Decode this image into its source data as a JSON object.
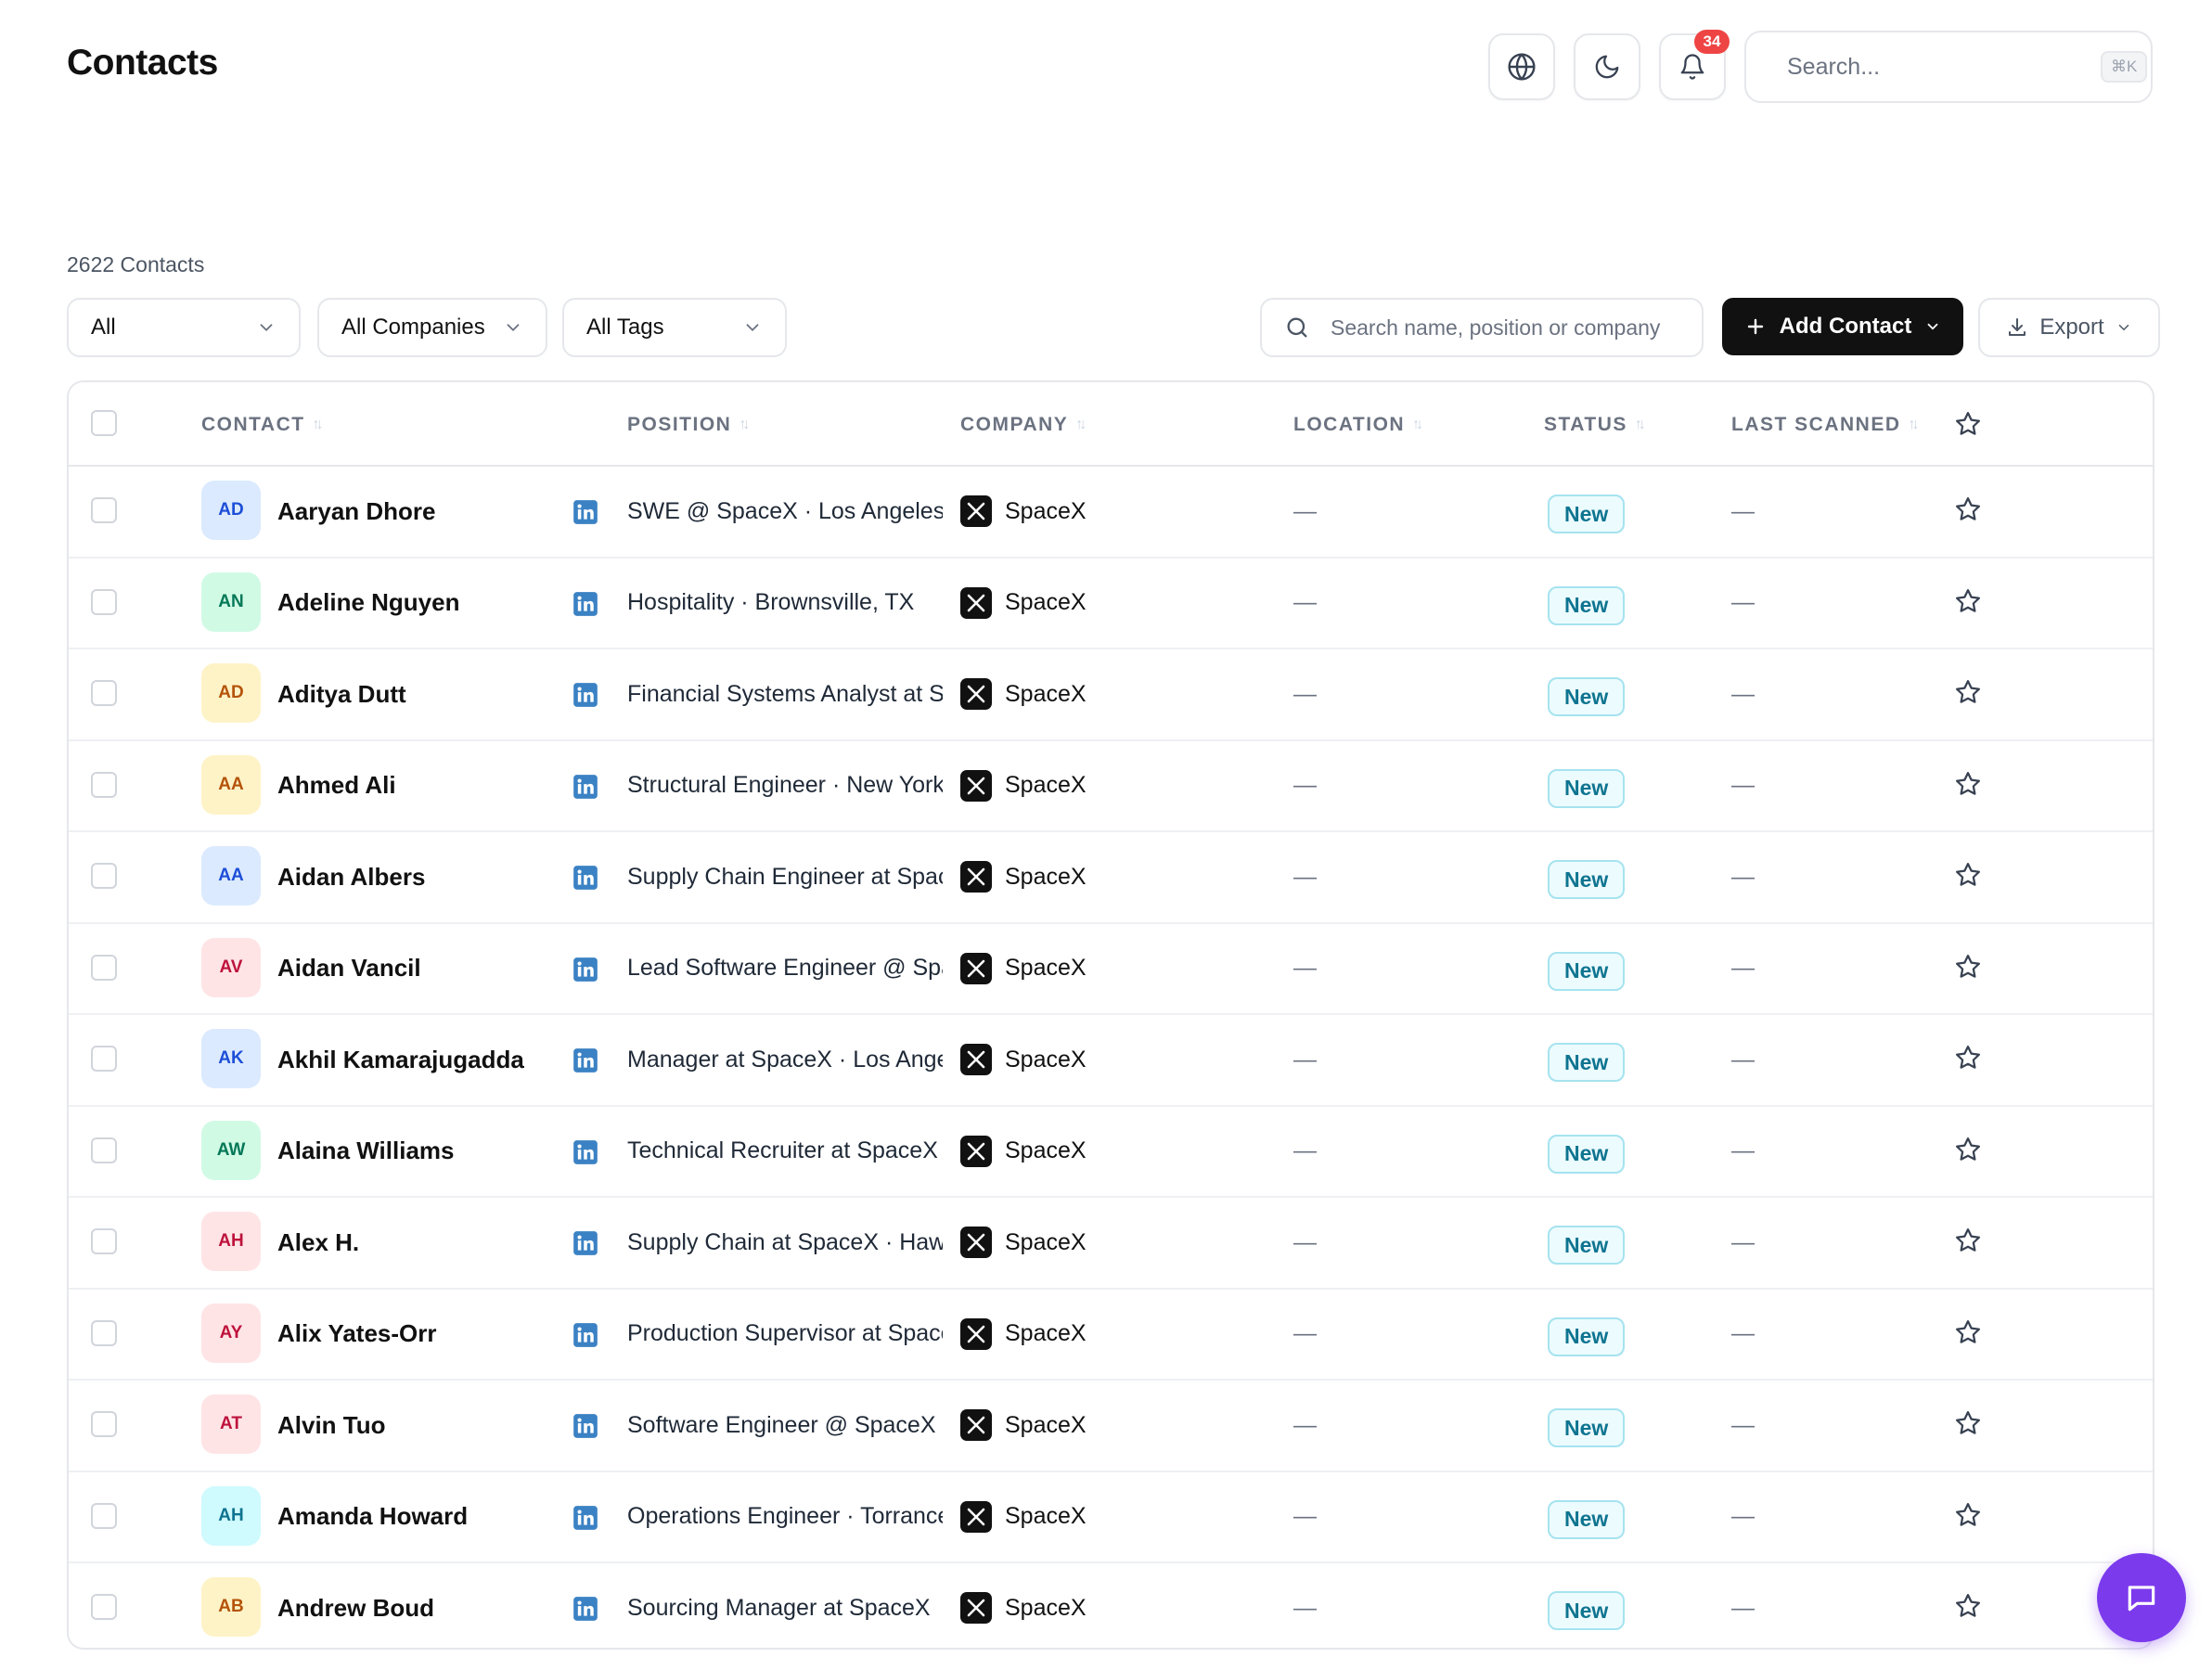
{
  "header": {
    "title": "Contacts",
    "notification_count": "34",
    "search_placeholder": "Search...",
    "search_shortcut": "⌘K",
    "icons": [
      "globe-icon",
      "moon-icon",
      "bell-icon",
      "search-icon"
    ]
  },
  "contacts_count_label": "2622 Contacts",
  "filters": {
    "view": "All",
    "companies": "All Companies",
    "tags": "All Tags",
    "table_search_placeholder": "Search name, position or company",
    "add_contact_label": "Add Contact",
    "export_label": "Export"
  },
  "table": {
    "columns": {
      "contact": "CONTACT",
      "position": "POSITION",
      "company": "COMPANY",
      "location": "LOCATION",
      "status": "STATUS",
      "last_scanned": "LAST SCANNED"
    },
    "rows": [
      {
        "initials": "AD",
        "name": "Aaryan Dhore",
        "position": "SWE @ SpaceX · Los Angeles, CA",
        "company": "SpaceX",
        "location": "—",
        "status": "New",
        "last_scanned": "—",
        "avatar_bg": "#dbeafe",
        "avatar_fg": "#1d4ed8"
      },
      {
        "initials": "AN",
        "name": "Adeline Nguyen",
        "position": "Hospitality · Brownsville, TX",
        "company": "SpaceX",
        "location": "—",
        "status": "New",
        "last_scanned": "—",
        "avatar_bg": "#d1fae5",
        "avatar_fg": "#047857"
      },
      {
        "initials": "AD",
        "name": "Aditya Dutt",
        "position": "Financial Systems Analyst at SpaceX",
        "company": "SpaceX",
        "location": "—",
        "status": "New",
        "last_scanned": "—",
        "avatar_bg": "#fef3c7",
        "avatar_fg": "#b45309"
      },
      {
        "initials": "AA",
        "name": "Ahmed Ali",
        "position": "Structural Engineer · New York",
        "company": "SpaceX",
        "location": "—",
        "status": "New",
        "last_scanned": "—",
        "avatar_bg": "#fef3c7",
        "avatar_fg": "#b45309"
      },
      {
        "initials": "AA",
        "name": "Aidan Albers",
        "position": "Supply Chain Engineer at SpaceX",
        "company": "SpaceX",
        "location": "—",
        "status": "New",
        "last_scanned": "—",
        "avatar_bg": "#dbeafe",
        "avatar_fg": "#1d4ed8"
      },
      {
        "initials": "AV",
        "name": "Aidan Vancil",
        "position": "Lead Software Engineer @ SpaceX",
        "company": "SpaceX",
        "location": "—",
        "status": "New",
        "last_scanned": "—",
        "avatar_bg": "#ffe4e6",
        "avatar_fg": "#be123c"
      },
      {
        "initials": "AK",
        "name": "Akhil Kamarajugadda",
        "position": "Manager at SpaceX · Los Angeles",
        "company": "SpaceX",
        "location": "—",
        "status": "New",
        "last_scanned": "—",
        "avatar_bg": "#dbeafe",
        "avatar_fg": "#1d4ed8"
      },
      {
        "initials": "AW",
        "name": "Alaina Williams",
        "position": "Technical Recruiter at SpaceX",
        "company": "SpaceX",
        "location": "—",
        "status": "New",
        "last_scanned": "—",
        "avatar_bg": "#d1fae5",
        "avatar_fg": "#047857"
      },
      {
        "initials": "AH",
        "name": "Alex H.",
        "position": "Supply Chain at SpaceX · Hawthorne",
        "company": "SpaceX",
        "location": "—",
        "status": "New",
        "last_scanned": "—",
        "avatar_bg": "#ffe4e6",
        "avatar_fg": "#be123c"
      },
      {
        "initials": "AY",
        "name": "Alix Yates-Orr",
        "position": "Production Supervisor at SpaceX",
        "company": "SpaceX",
        "location": "—",
        "status": "New",
        "last_scanned": "—",
        "avatar_bg": "#ffe4e6",
        "avatar_fg": "#be123c"
      },
      {
        "initials": "AT",
        "name": "Alvin Tuo",
        "position": "Software Engineer @ SpaceX",
        "company": "SpaceX",
        "location": "—",
        "status": "New",
        "last_scanned": "—",
        "avatar_bg": "#ffe4e6",
        "avatar_fg": "#be123c"
      },
      {
        "initials": "AH",
        "name": "Amanda Howard",
        "position": "Operations Engineer · Torrance, CA",
        "company": "SpaceX",
        "location": "—",
        "status": "New",
        "last_scanned": "—",
        "avatar_bg": "#cffafe",
        "avatar_fg": "#0e7490"
      },
      {
        "initials": "AB",
        "name": "Andrew Boud",
        "position": "Sourcing Manager at SpaceX",
        "company": "SpaceX",
        "location": "—",
        "status": "New",
        "last_scanned": "—",
        "avatar_bg": "#fef3c7",
        "avatar_fg": "#b45309"
      }
    ]
  },
  "chat_button_icon": "chat-icon"
}
